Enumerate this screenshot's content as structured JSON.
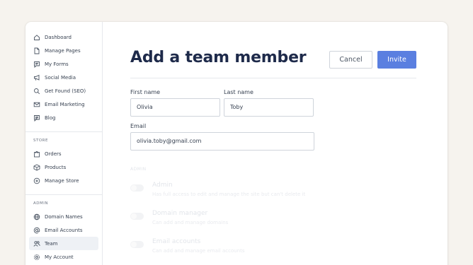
{
  "sidebar": {
    "main_items": [
      {
        "label": "Dashboard",
        "icon": "home-icon"
      },
      {
        "label": "Manage Pages",
        "icon": "page-icon"
      },
      {
        "label": "My Forms",
        "icon": "form-icon"
      },
      {
        "label": "Social Media",
        "icon": "megaphone-icon"
      },
      {
        "label": "Get Found (SEO)",
        "icon": "search-icon"
      },
      {
        "label": "Email Marketing",
        "icon": "mail-icon"
      },
      {
        "label": "Blog",
        "icon": "blog-icon"
      }
    ],
    "store_label": "STORE",
    "store_items": [
      {
        "label": "Orders",
        "icon": "bag-icon"
      },
      {
        "label": "Products",
        "icon": "box-icon"
      },
      {
        "label": "Manage Store",
        "icon": "store-icon"
      }
    ],
    "admin_label": "ADMIN",
    "admin_items": [
      {
        "label": "Domain Names",
        "icon": "globe-icon"
      },
      {
        "label": "Email Accounts",
        "icon": "at-icon"
      },
      {
        "label": "Team",
        "icon": "team-icon",
        "active": true
      },
      {
        "label": "My Account",
        "icon": "gear-icon"
      }
    ]
  },
  "main": {
    "title": "Add a team member",
    "cancel_label": "Cancel",
    "invite_label": "Invite",
    "first_name_label": "First name",
    "first_name_value": "Olivia",
    "last_name_label": "Last name",
    "last_name_value": "Toby",
    "email_label": "Email",
    "email_value": "olivia.toby@gmail.com",
    "permissions_label": "ADMIN",
    "permissions": [
      {
        "name": "Admin",
        "description": "Has full access to edit and manage the site but can't delete it"
      },
      {
        "name": "Domain manager",
        "description": "Can add and manage domains"
      },
      {
        "name": "Email accounts",
        "description": "Can add and manage email accounts"
      }
    ]
  },
  "colors": {
    "accent": "#5a7fe0",
    "title": "#1e2a4a",
    "background": "#f6f3ee"
  }
}
